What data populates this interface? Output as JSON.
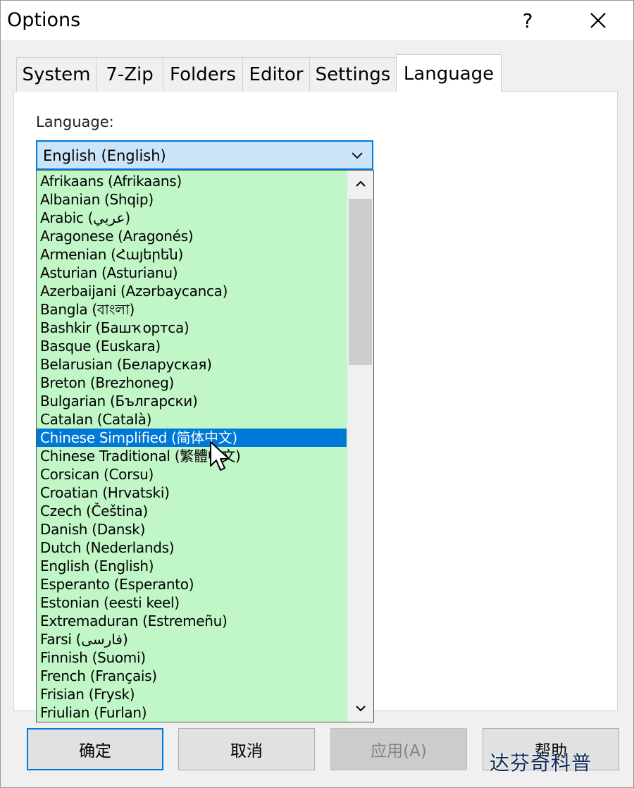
{
  "window": {
    "title": "Options",
    "help_symbol": "?",
    "close_symbol": "✕"
  },
  "tabs": [
    {
      "label": "System"
    },
    {
      "label": "7-Zip"
    },
    {
      "label": "Folders"
    },
    {
      "label": "Editor"
    },
    {
      "label": "Settings"
    },
    {
      "label": "Language",
      "active": true
    }
  ],
  "language": {
    "label": "Language:",
    "selected_value": "English (English)",
    "options": [
      "Afrikaans (Afrikaans)",
      "Albanian (Shqip)",
      "Arabic (عربي)",
      "Aragonese (Aragonés)",
      "Armenian (Հայերեն)",
      "Asturian (Asturianu)",
      "Azerbaijani (Azərbaycanca)",
      "Bangla (বাংলা)",
      "Bashkir (Башҡортса)",
      "Basque (Euskara)",
      "Belarusian (Беларуская)",
      "Breton (Brezhoneg)",
      "Bulgarian (Български)",
      "Catalan (Català)",
      "Chinese Simplified (简体中文)",
      "Chinese Traditional (繁體中文)",
      "Corsican (Corsu)",
      "Croatian (Hrvatski)",
      "Czech (Čeština)",
      "Danish (Dansk)",
      "Dutch (Nederlands)",
      "English (English)",
      "Esperanto (Esperanto)",
      "Estonian (eesti keel)",
      "Extremaduran (Estremeñu)",
      "Farsi (فارسی)",
      "Finnish (Suomi)",
      "French (Français)",
      "Frisian (Frysk)",
      "Friulian (Furlan)"
    ],
    "highlighted": "Chinese Simplified (简体中文)"
  },
  "buttons": {
    "ok": "确定",
    "cancel": "取消",
    "apply": "应用(A)",
    "help": "帮助"
  },
  "watermark": "达芬奇科普",
  "colors": {
    "list_background": "#c1f6c6",
    "selection": "#0078d7",
    "combo_background": "#cce4f7"
  }
}
